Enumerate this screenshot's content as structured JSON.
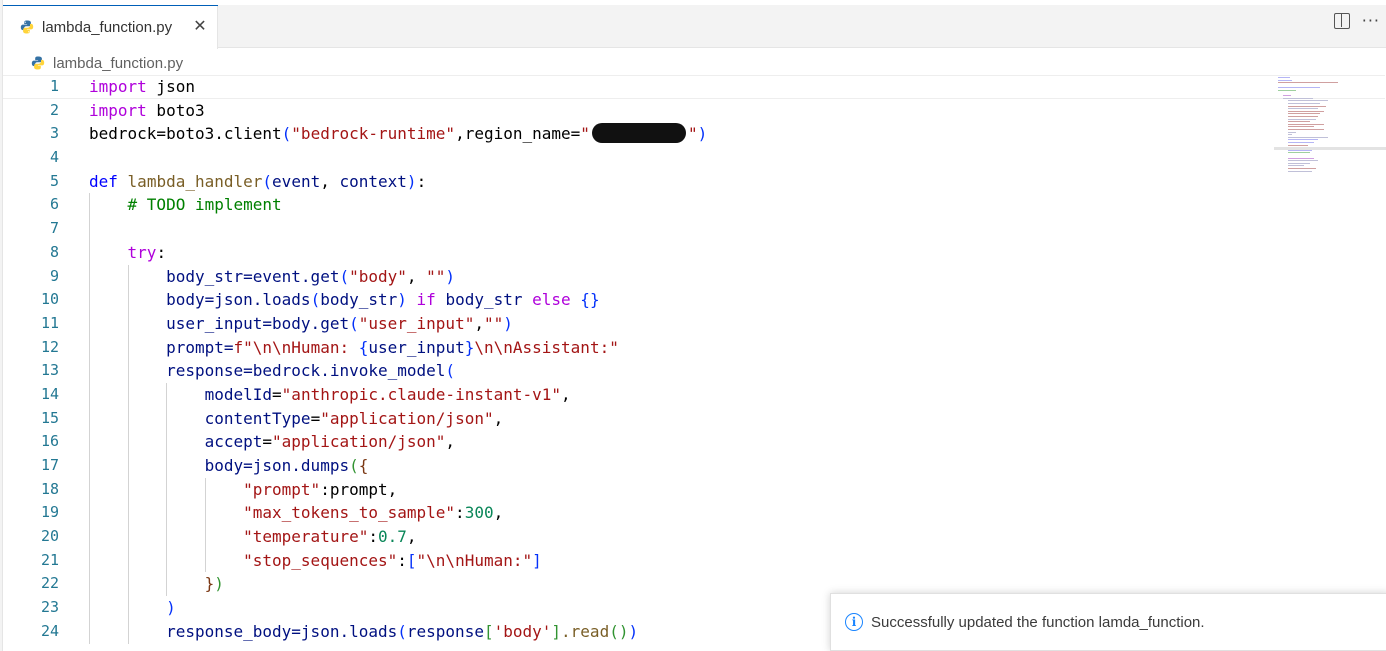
{
  "tab": {
    "label": "lambda_function.py",
    "icon": "python-file-icon"
  },
  "breadcrumb": {
    "file": "lambda_function.py"
  },
  "colors": {
    "accent": "#005fb8",
    "keyword": "#0000ff",
    "string": "#a31515",
    "number": "#098658",
    "comment": "#008000",
    "variable": "#001080",
    "function": "#795e26",
    "control": "#af00db",
    "info": "#1a85ff"
  },
  "editor": {
    "line_numbers": [
      "1",
      "2",
      "3",
      "4",
      "5",
      "6",
      "7",
      "8",
      "9",
      "10",
      "11",
      "12",
      "13",
      "14",
      "15",
      "16",
      "17",
      "18",
      "19",
      "20",
      "21",
      "22",
      "23",
      "24"
    ],
    "lines": {
      "l1_kw": "import",
      "l1_rest": " json",
      "l2_kw": "import",
      "l2_rest": " boto3",
      "l3_a": "bedrock=boto3.client",
      "l3_b": "(",
      "l3_c": "\"bedrock-runtime\"",
      "l3_d": ",region_name=",
      "l3_e": "\"",
      "l3_f": "\"",
      "l3_g": ")",
      "l5_kw": "def",
      "l5_fn": "lambda_handler",
      "l5_p1": "(",
      "l5_a1": "event",
      "l5_sep": ", ",
      "l5_a2": "context",
      "l5_p2": ")",
      "l5_colon": ":",
      "l6_cm": "# TODO implement",
      "l8_kw": "try",
      "l8_colon": ":",
      "l9_a": "body_str=event.get",
      "l9_b": "(",
      "l9_c": "\"body\"",
      "l9_d": ", ",
      "l9_e": "\"\"",
      "l9_f": ")",
      "l10_a": "body=json.loads",
      "l10_b": "(",
      "l10_c": "body_str",
      "l10_d": ")",
      "l10_e": " if ",
      "l10_f": "body_str ",
      "l10_g": "else",
      "l10_h": " {}",
      "l11_a": "user_input=body.get",
      "l11_b": "(",
      "l11_c": "\"user_input\"",
      "l11_d": ",",
      "l11_e": "\"\"",
      "l11_f": ")",
      "l12_a": "prompt=",
      "l12_b": "f\"",
      "l12_c": "\\n\\nHuman: ",
      "l12_d": "{",
      "l12_e": "user_input",
      "l12_f": "}",
      "l12_g": "\\n\\nAssistant:\"",
      "l13_a": "response=bedrock.invoke_model",
      "l13_b": "(",
      "l14_a": "modelId",
      "l14_b": "=",
      "l14_c": "\"anthropic.claude-instant-v1\"",
      "l14_d": ",",
      "l15_a": "contentType",
      "l15_b": "=",
      "l15_c": "\"application/json\"",
      "l15_d": ",",
      "l16_a": "accept",
      "l16_b": "=",
      "l16_c": "\"application/json\"",
      "l16_d": ",",
      "l17_a": "body",
      "l17_b": "=json.dumps",
      "l17_c": "(",
      "l17_d": "{",
      "l18_a": "\"prompt\"",
      "l18_b": ":prompt,",
      "l19_a": "\"max_tokens_to_sample\"",
      "l19_b": ":",
      "l19_c": "300",
      "l19_d": ",",
      "l20_a": "\"temperature\"",
      "l20_b": ":",
      "l20_c": "0.7",
      "l20_d": ",",
      "l21_a": "\"stop_sequences\"",
      "l21_b": ":",
      "l21_c": "[",
      "l21_d": "\"\\n\\nHuman:\"",
      "l21_e": "]",
      "l22_a": "}",
      "l22_b": ")",
      "l23_a": ")",
      "l24_a": "response_body=json.loads",
      "l24_b": "(",
      "l24_c": "response",
      "l24_d": "[",
      "l24_e": "'body'",
      "l24_f": "]",
      "l24_g": ".read",
      "l24_h": "()",
      "l24_i": ")"
    }
  },
  "notification": {
    "message": "Successfully updated the function lamda_function.",
    "icon": "info-icon"
  }
}
